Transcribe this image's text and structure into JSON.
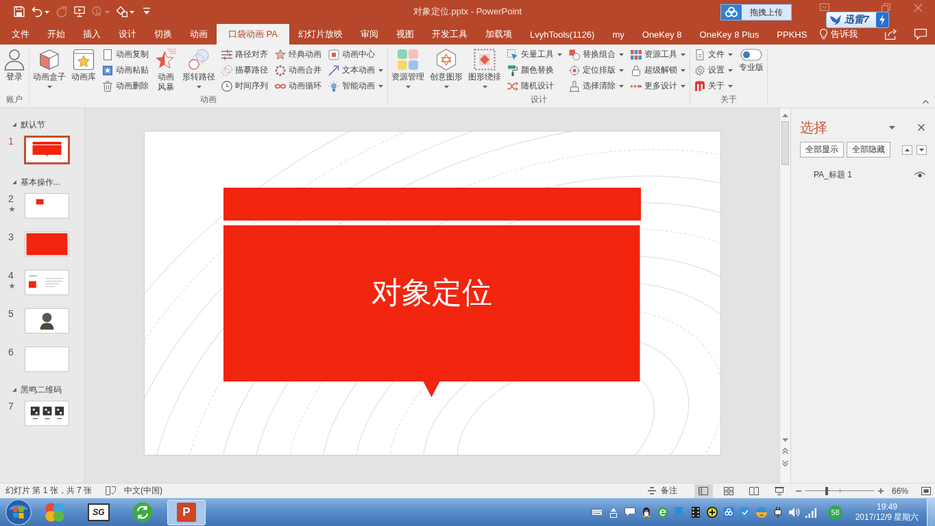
{
  "title_bar": {
    "quick_access": [
      {
        "kind": "save",
        "disabled": false,
        "dropdown": false
      },
      {
        "kind": "undo",
        "disabled": false,
        "dropdown": true
      },
      {
        "kind": "redo",
        "disabled": true,
        "dropdown": false
      },
      {
        "kind": "present",
        "disabled": false,
        "dropdown": false
      },
      {
        "kind": "touch",
        "disabled": true,
        "dropdown": true
      },
      {
        "kind": "shape",
        "disabled": false,
        "dropdown": true
      },
      {
        "kind": "customize",
        "disabled": false,
        "dropdown": false
      }
    ],
    "title": "对象定位.pptx - PowerPoint",
    "upload_button": "拖拽上传",
    "thunder_badge": "迅雷7"
  },
  "tabs": [
    {
      "label": "文件",
      "selected": false
    },
    {
      "label": "开始",
      "selected": false
    },
    {
      "label": "插入",
      "selected": false
    },
    {
      "label": "设计",
      "selected": false
    },
    {
      "label": "切换",
      "selected": false
    },
    {
      "label": "动画",
      "selected": false
    },
    {
      "label": "口袋动画 PA",
      "selected": true
    },
    {
      "label": "幻灯片放映",
      "selected": false
    },
    {
      "label": "审阅",
      "selected": false
    },
    {
      "label": "视图",
      "selected": false
    },
    {
      "label": "开发工具",
      "selected": false
    },
    {
      "label": "加载项",
      "selected": false
    },
    {
      "label": "LvyhTools(1126)",
      "selected": false
    },
    {
      "label": "my",
      "selected": false
    },
    {
      "label": "OneKey 8",
      "selected": false
    },
    {
      "label": "OneKey 8 Plus",
      "selected": false
    },
    {
      "label": "PPKHS",
      "selected": false
    }
  ],
  "tell_me": "告诉我",
  "ribbon": {
    "groups": [
      {
        "label": "账户",
        "items": [
          {
            "kind": "large",
            "label": "登录",
            "dropdown": false
          }
        ]
      },
      {
        "label": "动画",
        "items": [
          {
            "kind": "large",
            "label": "动画盒子",
            "dropdown": true
          },
          {
            "kind": "large",
            "label": "动画库",
            "dropdown": false
          },
          {
            "kind": "column",
            "buttons": [
              {
                "label": "动画复制",
                "dropdown": false
              },
              {
                "label": "动画粘贴",
                "dropdown": false
              },
              {
                "label": "动画删除",
                "dropdown": false
              }
            ]
          },
          {
            "kind": "large",
            "label": "动画风暴",
            "dropdown": false,
            "wrap": true
          },
          {
            "kind": "large",
            "label": "形转路径",
            "dropdown": true
          },
          {
            "kind": "column",
            "buttons": [
              {
                "label": "路径对齐",
                "dropdown": false
              },
              {
                "label": "描摹路径",
                "dropdown": false
              },
              {
                "label": "时间序列",
                "dropdown": false
              }
            ]
          },
          {
            "kind": "column",
            "buttons": [
              {
                "label": "经典动画",
                "dropdown": false
              },
              {
                "label": "动画合并",
                "dropdown": false
              },
              {
                "label": "动画循环",
                "dropdown": false
              }
            ]
          },
          {
            "kind": "column",
            "buttons": [
              {
                "label": "动画中心",
                "dropdown": false
              },
              {
                "label": "文本动画",
                "dropdown": true
              },
              {
                "label": "智能动画",
                "dropdown": true
              }
            ]
          }
        ]
      },
      {
        "label": "设计",
        "items": [
          {
            "kind": "large",
            "label": "资源管理",
            "dropdown": true
          },
          {
            "kind": "large",
            "label": "创意图形",
            "dropdown": true
          },
          {
            "kind": "large",
            "label": "图形绕排",
            "dropdown": true
          },
          {
            "kind": "column",
            "buttons": [
              {
                "label": "矢量工具",
                "dropdown": true
              },
              {
                "label": "颜色替换",
                "dropdown": false
              },
              {
                "label": "随机设计",
                "dropdown": false
              }
            ]
          },
          {
            "kind": "column",
            "buttons": [
              {
                "label": "替换组合",
                "dropdown": true
              },
              {
                "label": "定位排版",
                "dropdown": true
              },
              {
                "label": "选择清除",
                "dropdown": true
              }
            ]
          },
          {
            "kind": "column",
            "buttons": [
              {
                "label": "资源工具",
                "dropdown": true
              },
              {
                "label": "超级解锁",
                "dropdown": true
              },
              {
                "label": "更多设计",
                "dropdown": true
              }
            ]
          }
        ]
      },
      {
        "label": "关于",
        "items": [
          {
            "kind": "column",
            "buttons": [
              {
                "label": "文件",
                "dropdown": true
              },
              {
                "label": "设置",
                "dropdown": true
              },
              {
                "label": "关于",
                "dropdown": true
              }
            ]
          },
          {
            "kind": "large",
            "label": "专业版",
            "dropdown": false
          }
        ]
      }
    ]
  },
  "slides_panel": {
    "sections": [
      {
        "title": "默认节",
        "expanded": true,
        "slides": [
          {
            "number": "1",
            "kind": "title-card",
            "selected": true,
            "animated": false
          }
        ]
      },
      {
        "title": "基本操作...",
        "expanded": true,
        "slides": [
          {
            "number": "2",
            "kind": "small-shape",
            "selected": false,
            "animated": true
          },
          {
            "number": "3",
            "kind": "full-fill",
            "selected": false,
            "animated": false
          },
          {
            "number": "4",
            "kind": "text-layout",
            "selected": false,
            "animated": true
          },
          {
            "number": "5",
            "kind": "character",
            "selected": false,
            "animated": false
          },
          {
            "number": "6",
            "kind": "blank",
            "selected": false,
            "animated": false
          }
        ]
      },
      {
        "title": "黑鸣二维码",
        "expanded": true,
        "slides": [
          {
            "number": "7",
            "kind": "qr-codes",
            "selected": false,
            "animated": false
          }
        ]
      }
    ]
  },
  "slide": {
    "title": "对象定位"
  },
  "selection_pane": {
    "title": "选择",
    "buttons": [
      "全部显示",
      "全部隐藏"
    ],
    "items": [
      {
        "label": "PA_标题 1",
        "visible": true
      }
    ]
  },
  "status_bar": {
    "slide_info": "幻灯片 第 1 张，共 7 张",
    "language": "中文(中国)",
    "notes": "备注",
    "views": [
      {
        "kind": "normal",
        "selected": true
      },
      {
        "kind": "sorter",
        "selected": false
      },
      {
        "kind": "reading",
        "selected": false
      },
      {
        "kind": "slideshow",
        "selected": false
      }
    ],
    "zoom": {
      "level": 0.31,
      "reading": "66%"
    }
  },
  "taskbar": {
    "apps": [
      {
        "kind": "colorful",
        "active": false
      },
      {
        "kind": "monitor",
        "glyph": "SG",
        "active": false
      },
      {
        "kind": "refresh",
        "active": false
      },
      {
        "kind": "powerpoint",
        "glyph": "P",
        "active": true
      }
    ],
    "tray_badge": "58",
    "time": "19:49",
    "date": "2017/12/9 星期六"
  }
}
